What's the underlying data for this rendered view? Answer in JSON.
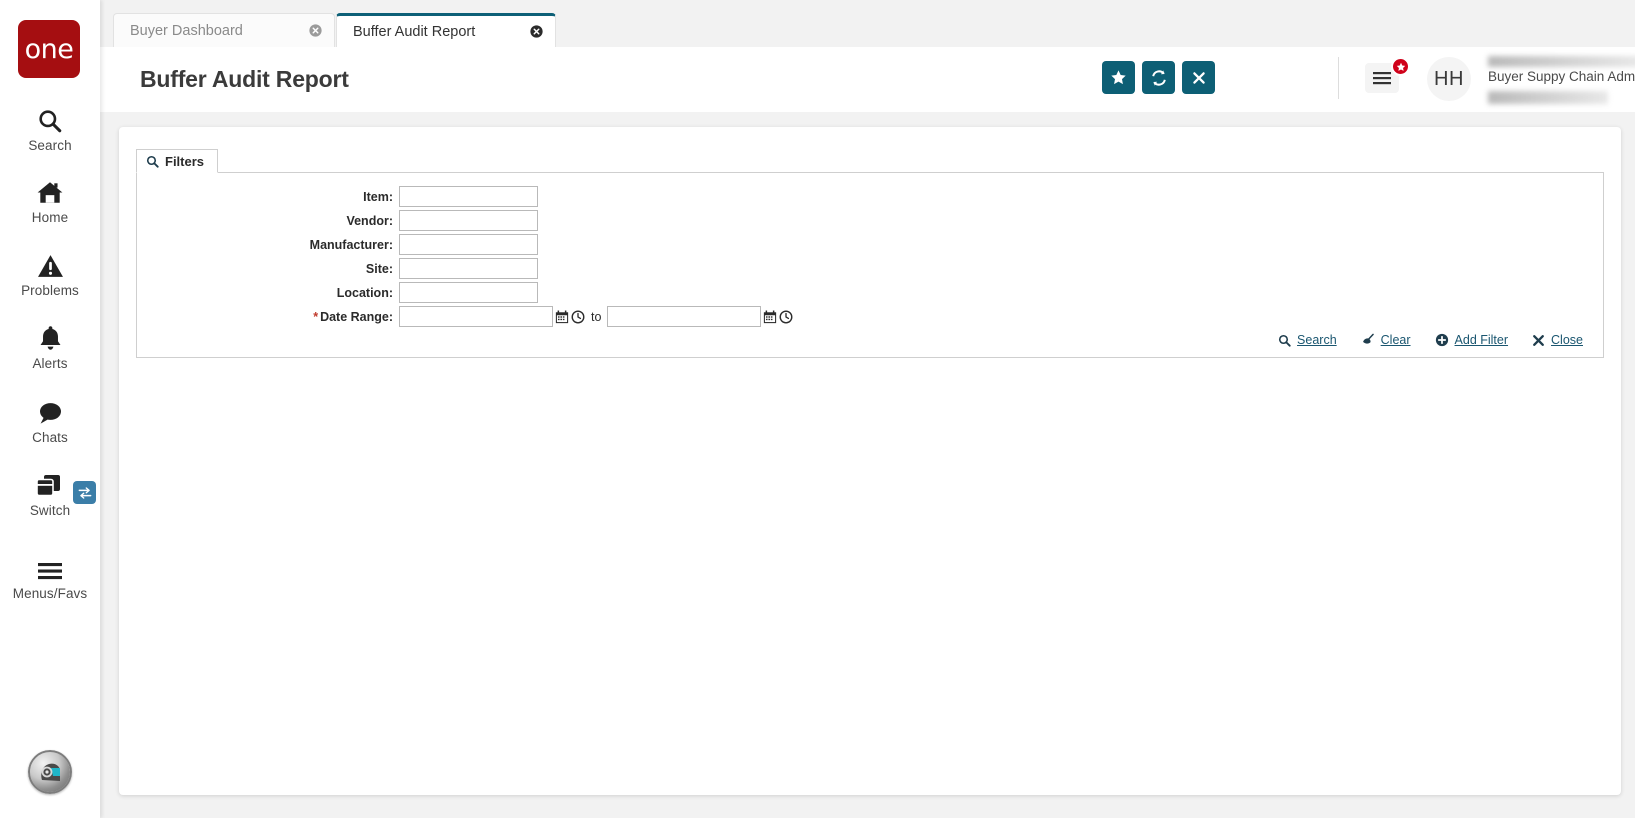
{
  "sidebar": {
    "logo_text": "one",
    "items": [
      {
        "label": "Search",
        "icon": "search-icon"
      },
      {
        "label": "Home",
        "icon": "home-icon"
      },
      {
        "label": "Problems",
        "icon": "warning-triangle-icon"
      },
      {
        "label": "Alerts",
        "icon": "bell-icon"
      },
      {
        "label": "Chats",
        "icon": "chat-bubble-icon"
      },
      {
        "label": "Switch",
        "icon": "windows-stack-icon"
      },
      {
        "label": "Menus/Favs",
        "icon": "hamburger-icon"
      }
    ],
    "switch_badge_icon": "exchange-arrows-icon",
    "bottom_avatar_icon": "assistant-avatar-icon"
  },
  "tabs": [
    {
      "label": "Buyer Dashboard",
      "active": false,
      "close_icon": "close-circle-icon"
    },
    {
      "label": "Buffer Audit Report",
      "active": true,
      "close_icon": "close-circle-icon"
    }
  ],
  "header": {
    "title": "Buffer Audit Report",
    "buttons": [
      {
        "name": "favorite-button",
        "icon": "star-icon"
      },
      {
        "name": "refresh-button",
        "icon": "refresh-icon"
      },
      {
        "name": "close-button",
        "icon": "x-icon"
      }
    ],
    "menu_icon": "hamburger-icon",
    "menu_badge_icon": "star-icon",
    "avatar_initials": "HH",
    "user_role": "Buyer Suppy Chain Admin",
    "dropdown_icon": "chevron-down-icon"
  },
  "filters": {
    "tab_label": "Filters",
    "tab_icon": "search-icon",
    "fields": [
      {
        "label": "Item:",
        "value": "",
        "placeholder": "",
        "required": false
      },
      {
        "label": "Vendor:",
        "value": "",
        "placeholder": "",
        "required": false
      },
      {
        "label": "Manufacturer:",
        "value": "",
        "placeholder": "",
        "required": false
      },
      {
        "label": "Site:",
        "value": "",
        "placeholder": "",
        "required": false
      },
      {
        "label": "Location:",
        "value": "",
        "placeholder": "",
        "required": false
      }
    ],
    "date_range": {
      "label": "Date Range:",
      "required": true,
      "required_marker": "*",
      "from_value": "",
      "to_value": "",
      "separator": "to",
      "calendar_icon": "calendar-icon",
      "clock_icon": "clock-icon"
    },
    "actions": [
      {
        "label": "Search",
        "icon": "search-icon"
      },
      {
        "label": "Clear",
        "icon": "broom-icon"
      },
      {
        "label": "Add Filter",
        "icon": "plus-circle-icon"
      },
      {
        "label": "Close",
        "icon": "x-icon"
      }
    ]
  },
  "colors": {
    "brand_red": "#a50e11",
    "teal_accent": "#0d5f75",
    "link": "#1a5670",
    "badge_red": "#d0021b",
    "switch_badge_blue": "#3b7ea8",
    "required_red": "#c0392b",
    "page_bg": "#f2f2f2"
  }
}
